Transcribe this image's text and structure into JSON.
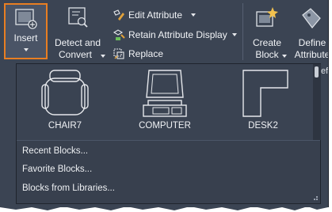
{
  "ribbon": {
    "insert_label": "Insert",
    "detect_label_1": "Detect and",
    "detect_label_2": "Convert",
    "edit_attribute_label": "Edit Attribute",
    "retain_label": "Retain Attribute Display",
    "replace_label": "Replace",
    "create_label_1": "Create",
    "create_label_2": "Block",
    "define_label_1": "Define",
    "define_label_2": "Attribute",
    "clipped_text": "ef"
  },
  "gallery": {
    "blocks": [
      {
        "name": "CHAIR7",
        "icon": "chair-icon"
      },
      {
        "name": "COMPUTER",
        "icon": "computer-icon"
      },
      {
        "name": "DESK2",
        "icon": "desk-icon"
      }
    ]
  },
  "menu": {
    "items": [
      {
        "label": "Recent Blocks..."
      },
      {
        "label": "Favorite Blocks..."
      },
      {
        "label": "Blocks from Libraries..."
      }
    ]
  },
  "colors": {
    "ribbon_bg": "#3b4453",
    "panel_bg": "#38404e",
    "highlight": "#e87e22",
    "text": "#f2f4f7"
  }
}
